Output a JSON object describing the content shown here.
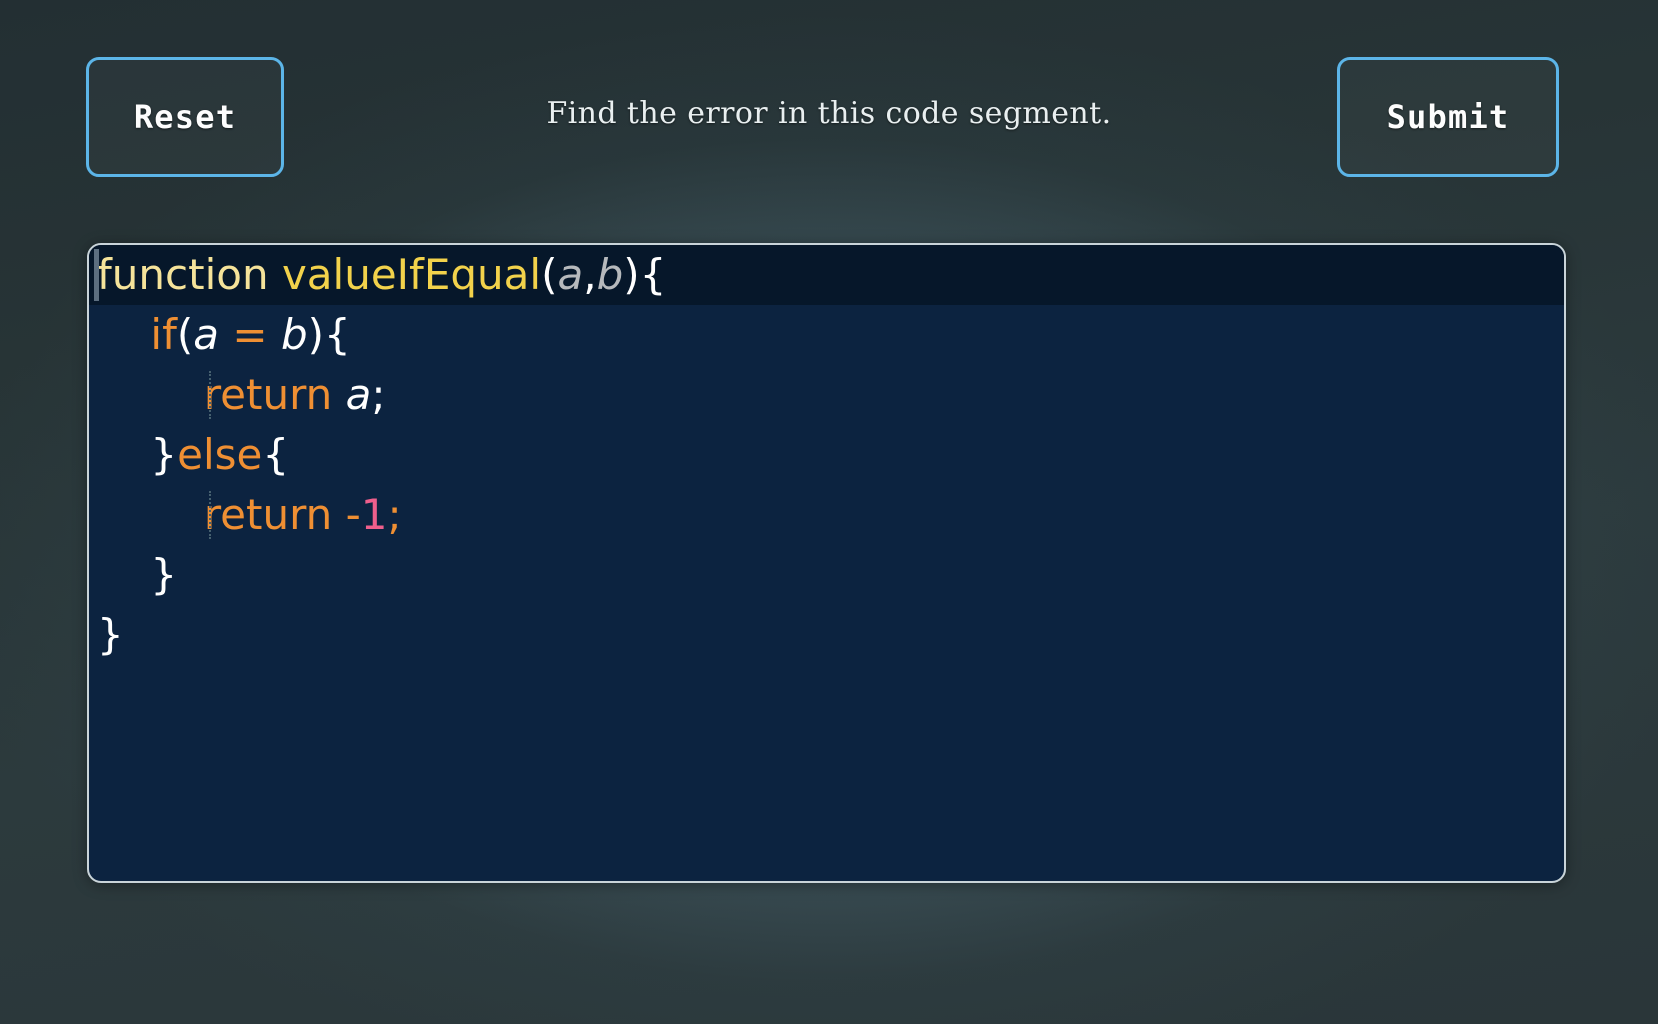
{
  "toolbar": {
    "reset_label": "Reset",
    "submit_label": "Submit",
    "prompt": "Find the error in this code segment.",
    "accent_color": "#5cb5e8",
    "text_color": "#fdfdfd"
  },
  "editor": {
    "background": "#0c2340",
    "active_line_background": "#06172a",
    "border_color": "#c9d4d9",
    "caret_color": "#5d6f80",
    "active_line_number": 1,
    "language": "javascript",
    "full_text": "function valueIfEqual(a,b){\n    if(a = b){\n        return a;\n    }else{\n        return -1;\n    }\n}",
    "lines": [
      {
        "number": 1,
        "indent": 0,
        "tokens": [
          {
            "text": "function",
            "type": "fn"
          },
          {
            "text": " ",
            "type": "punc"
          },
          {
            "text": "valueIfEqual",
            "type": "fnname"
          },
          {
            "text": "(",
            "type": "punc"
          },
          {
            "text": "a",
            "type": "param"
          },
          {
            "text": ",",
            "type": "punc"
          },
          {
            "text": "b",
            "type": "param"
          },
          {
            "text": ")",
            "type": "punc"
          },
          {
            "text": "{",
            "type": "punc"
          }
        ]
      },
      {
        "number": 2,
        "indent": 1,
        "tokens": [
          {
            "text": "    ",
            "type": "punc"
          },
          {
            "text": "if",
            "type": "kw"
          },
          {
            "text": "(",
            "type": "punc"
          },
          {
            "text": "a",
            "type": "var"
          },
          {
            "text": " ",
            "type": "punc"
          },
          {
            "text": "=",
            "type": "op"
          },
          {
            "text": " ",
            "type": "punc"
          },
          {
            "text": "b",
            "type": "var"
          },
          {
            "text": ")",
            "type": "punc"
          },
          {
            "text": "{",
            "type": "punc"
          }
        ]
      },
      {
        "number": 3,
        "indent": 2,
        "tokens": [
          {
            "text": "        ",
            "type": "punc"
          },
          {
            "text": "return",
            "type": "kw"
          },
          {
            "text": " ",
            "type": "punc"
          },
          {
            "text": "a",
            "type": "var"
          },
          {
            "text": ";",
            "type": "punc"
          }
        ]
      },
      {
        "number": 4,
        "indent": 1,
        "tokens": [
          {
            "text": "    ",
            "type": "punc"
          },
          {
            "text": "}",
            "type": "punc"
          },
          {
            "text": "else",
            "type": "kw"
          },
          {
            "text": "{",
            "type": "punc"
          }
        ]
      },
      {
        "number": 5,
        "indent": 2,
        "tokens": [
          {
            "text": "        ",
            "type": "punc"
          },
          {
            "text": "return",
            "type": "kw"
          },
          {
            "text": " ",
            "type": "punc"
          },
          {
            "text": "-",
            "type": "op"
          },
          {
            "text": "1",
            "type": "num"
          },
          {
            "text": ";",
            "type": "op"
          }
        ]
      },
      {
        "number": 6,
        "indent": 1,
        "tokens": [
          {
            "text": "    ",
            "type": "punc"
          },
          {
            "text": "}",
            "type": "punc"
          }
        ]
      },
      {
        "number": 7,
        "indent": 0,
        "tokens": [
          {
            "text": "}",
            "type": "punc"
          }
        ]
      }
    ]
  }
}
